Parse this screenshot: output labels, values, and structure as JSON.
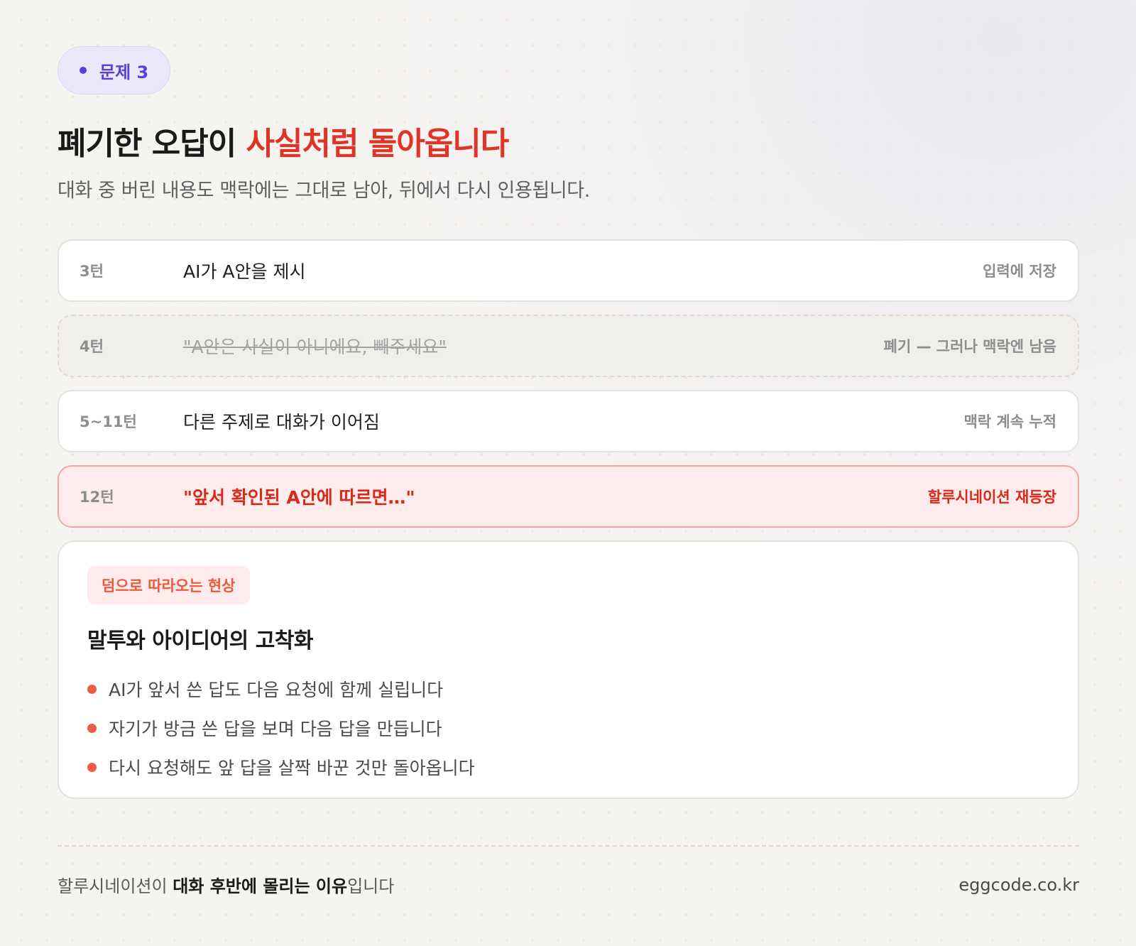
{
  "tag": {
    "label": "문제 3"
  },
  "header": {
    "title_plain": "폐기한 오답이 ",
    "title_accent": "사실처럼 돌아옵니다",
    "subtitle": "대화 중 버린 내용도 맥락에는 그대로 남아, 뒤에서 다시 인용됩니다."
  },
  "turns": [
    {
      "turn": "3턴",
      "text": "AI가 A안을 제시",
      "note": "입력에 저장",
      "state": "normal"
    },
    {
      "turn": "4턴",
      "text": "\"A안은 사실이 아니에요, 빼주세요\"",
      "note": "폐기 — 그러나 맥락엔 남음",
      "state": "discarded"
    },
    {
      "turn": "5~11턴",
      "text": "다른 주제로 대화가 이어짐",
      "note": "맥락 계속 누적",
      "state": "normal"
    },
    {
      "turn": "12턴",
      "text": "\"앞서 확인된 A안에 따르면…\"",
      "note": "할루시네이션 재등장",
      "state": "danger"
    }
  ],
  "card": {
    "chip": "덤으로 따라오는 현상",
    "title": "말투와 아이디어의 고착화",
    "bullets": [
      "AI가 앞서 쓴 답도 다음 요청에 함께 실립니다",
      "자기가 방금 쓴 답을 보며 다음 답을 만듭니다",
      "다시 요청해도 앞 답을 살짝 바꾼 것만 돌아옵니다"
    ]
  },
  "footer": {
    "text_before": "할루시네이션이 ",
    "text_strong": "대화 후반에 몰리는 이유",
    "text_after": "입니다",
    "site": "eggcode.co.kr"
  },
  "colors": {
    "accent_red": "#e03426",
    "tag_purple": "#5b3fd6",
    "bullet_orange": "#ee5d43"
  }
}
